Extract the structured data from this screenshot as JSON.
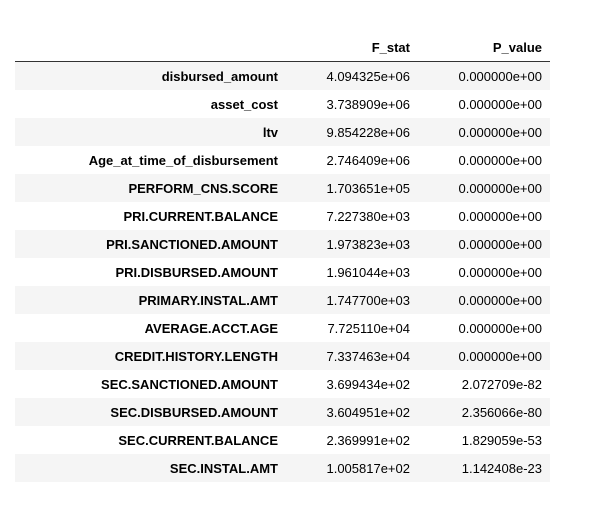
{
  "columns": [
    "",
    "F_stat",
    "P_value"
  ],
  "rows": [
    {
      "index": "disbursed_amount",
      "F_stat": "4.094325e+06",
      "P_value": "0.000000e+00"
    },
    {
      "index": "asset_cost",
      "F_stat": "3.738909e+06",
      "P_value": "0.000000e+00"
    },
    {
      "index": "ltv",
      "F_stat": "9.854228e+06",
      "P_value": "0.000000e+00"
    },
    {
      "index": "Age_at_time_of_disbursement",
      "F_stat": "2.746409e+06",
      "P_value": "0.000000e+00"
    },
    {
      "index": "PERFORM_CNS.SCORE",
      "F_stat": "1.703651e+05",
      "P_value": "0.000000e+00"
    },
    {
      "index": "PRI.CURRENT.BALANCE",
      "F_stat": "7.227380e+03",
      "P_value": "0.000000e+00"
    },
    {
      "index": "PRI.SANCTIONED.AMOUNT",
      "F_stat": "1.973823e+03",
      "P_value": "0.000000e+00"
    },
    {
      "index": "PRI.DISBURSED.AMOUNT",
      "F_stat": "1.961044e+03",
      "P_value": "0.000000e+00"
    },
    {
      "index": "PRIMARY.INSTAL.AMT",
      "F_stat": "1.747700e+03",
      "P_value": "0.000000e+00"
    },
    {
      "index": "AVERAGE.ACCT.AGE",
      "F_stat": "7.725110e+04",
      "P_value": "0.000000e+00"
    },
    {
      "index": "CREDIT.HISTORY.LENGTH",
      "F_stat": "7.337463e+04",
      "P_value": "0.000000e+00"
    },
    {
      "index": "SEC.SANCTIONED.AMOUNT",
      "F_stat": "3.699434e+02",
      "P_value": "2.072709e-82"
    },
    {
      "index": "SEC.DISBURSED.AMOUNT",
      "F_stat": "3.604951e+02",
      "P_value": "2.356066e-80"
    },
    {
      "index": "SEC.CURRENT.BALANCE",
      "F_stat": "2.369991e+02",
      "P_value": "1.829059e-53"
    },
    {
      "index": "SEC.INSTAL.AMT",
      "F_stat": "1.005817e+02",
      "P_value": "1.142408e-23"
    }
  ]
}
